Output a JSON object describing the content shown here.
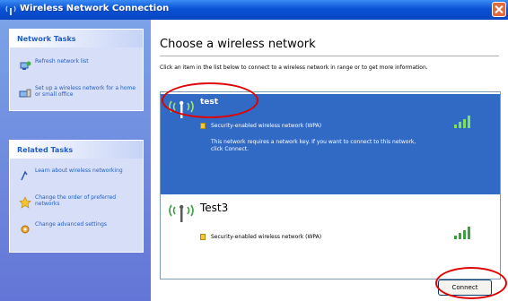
{
  "window": {
    "title": "Wireless Network Connection"
  },
  "sidebar": {
    "network_tasks": {
      "heading": "Network Tasks",
      "items": [
        {
          "label": "Refresh network list",
          "icon": "refresh-icon"
        },
        {
          "label": "Set up a wireless network for a home or small office",
          "icon": "setup-network-icon"
        }
      ]
    },
    "related_tasks": {
      "heading": "Related Tasks",
      "items": [
        {
          "label": "Learn about wireless networking",
          "icon": "info-icon"
        },
        {
          "label": "Change the order of preferred networks",
          "icon": "star-icon"
        },
        {
          "label": "Change advanced settings",
          "icon": "settings-icon"
        }
      ]
    }
  },
  "main": {
    "heading": "Choose a wireless network",
    "instruction": "Click an item in the list below to connect to a wireless network in range or to get more information.",
    "networks": [
      {
        "ssid": "test",
        "security": "Security-enabled wireless network (WPA)",
        "note": "This network requires a network key. If you want to connect to this network, click Connect.",
        "selected": true
      },
      {
        "ssid": "Test3",
        "security": "Security-enabled wireless network (WPA)",
        "selected": false
      }
    ],
    "connect_label": "Connect"
  },
  "colors": {
    "title_bar": "#0a52d6",
    "sidebar": "#6f8ee0",
    "selection": "#316ac5",
    "callout": "#e00000"
  }
}
